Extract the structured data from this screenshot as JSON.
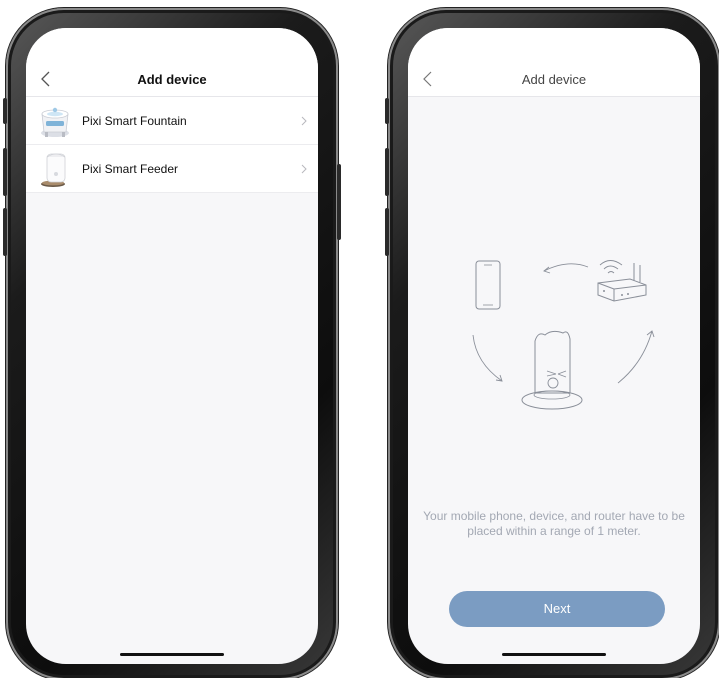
{
  "left_screen": {
    "nav_title": "Add device",
    "back_icon": "chevron-left-icon",
    "devices": [
      {
        "label": "Pixi Smart Fountain",
        "icon": "fountain-product-image",
        "chevron": "chevron-right-icon"
      },
      {
        "label": "Pixi Smart Feeder",
        "icon": "feeder-product-image",
        "chevron": "chevron-right-icon"
      }
    ]
  },
  "right_screen": {
    "nav_title": "Add device",
    "back_icon": "chevron-left-icon",
    "illustration_icons": [
      "phone-icon",
      "router-icon",
      "feeder-icon"
    ],
    "instruction": "Your mobile phone, device, and router have to be placed within a range of 1 meter.",
    "next_label": "Next"
  },
  "colors": {
    "screen_bg": "#f7f7f9",
    "accent_button": "#7b9cc2",
    "hint_text": "#a3a8b3"
  }
}
